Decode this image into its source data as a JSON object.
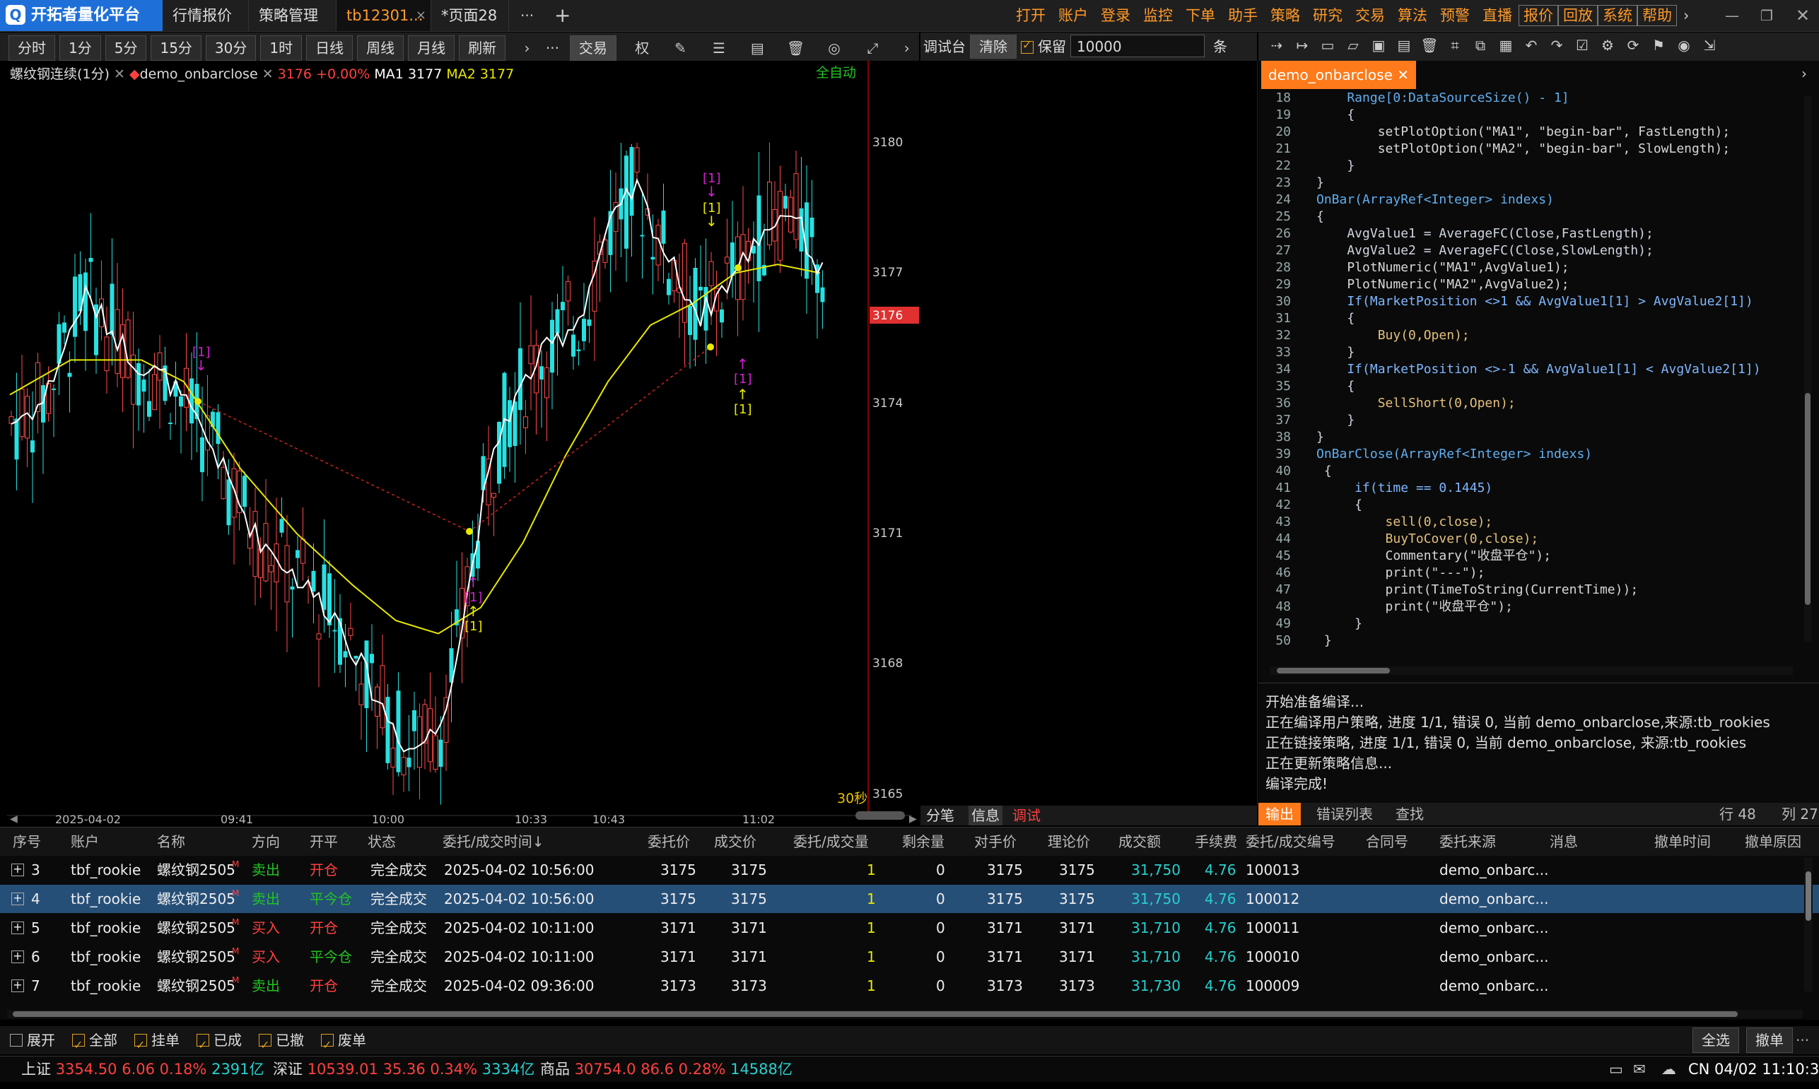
{
  "app": {
    "title": "开拓者量化平台"
  },
  "tabs": [
    {
      "label": "行情报价"
    },
    {
      "label": "策略管理"
    },
    {
      "label": "tb12301..."
    },
    {
      "label": "*页面28"
    }
  ],
  "top_menu": [
    "打开",
    "账户",
    "登录",
    "监控",
    "下单",
    "助手",
    "策略",
    "研究",
    "交易",
    "算法",
    "预警",
    "直播"
  ],
  "top_menu_boxed": [
    "报价",
    "回放",
    "系统",
    "帮助"
  ],
  "periods": [
    "分时",
    "1分",
    "5分",
    "15分",
    "30分",
    "1时",
    "日线",
    "周线",
    "月线",
    "刷新"
  ],
  "chart_toolbar": {
    "trade": "交易",
    "quan": "权"
  },
  "debug": {
    "label": "调试台",
    "clear": "清除",
    "keep": "保留",
    "count": "10000",
    "unit": "条"
  },
  "chart_header": {
    "symbol": "螺纹钢连续(1分)",
    "strategy": "demo_onbarclose",
    "price": "3176",
    "change": "+0.00%",
    "ma1_label": "MA1",
    "ma1_value": "3177",
    "ma2_label": "MA2",
    "ma2_value": "3177",
    "auto": "全自动",
    "countdown": "30秒"
  },
  "price_axis": [
    "3180",
    "3177",
    "3176",
    "3174",
    "3171",
    "3168",
    "3165"
  ],
  "time_axis": [
    "2025-04-02",
    "09:41",
    "10:00",
    "10:33",
    "10:43",
    "11:02"
  ],
  "signals": {
    "m": "[1]"
  },
  "editor": {
    "tab": "demo_onbarclose",
    "lines": [
      {
        "n": "18",
        "t": "    Range[0:DataSourceSize() - 1]"
      },
      {
        "n": "19",
        "t": "    {"
      },
      {
        "n": "20",
        "t": "        setPlotOption(\"MA1\", \"begin-bar\", FastLength);"
      },
      {
        "n": "21",
        "t": "        setPlotOption(\"MA2\", \"begin-bar\", SlowLength);"
      },
      {
        "n": "22",
        "t": "    }"
      },
      {
        "n": "23",
        "t": "}"
      },
      {
        "n": "24",
        "t": "OnBar(ArrayRef<Integer> indexs)"
      },
      {
        "n": "25",
        "t": "{"
      },
      {
        "n": "26",
        "t": "    AvgValue1 = AverageFC(Close,FastLength);"
      },
      {
        "n": "27",
        "t": "    AvgValue2 = AverageFC(Close,SlowLength);"
      },
      {
        "n": "28",
        "t": "    PlotNumeric(\"MA1\",AvgValue1);"
      },
      {
        "n": "29",
        "t": "    PlotNumeric(\"MA2\",AvgValue2);"
      },
      {
        "n": "30",
        "t": "    If(MarketPosition <>1 && AvgValue1[1] > AvgValue2[1])"
      },
      {
        "n": "31",
        "t": "    {"
      },
      {
        "n": "32",
        "t": "        Buy(0,Open);"
      },
      {
        "n": "33",
        "t": "    }"
      },
      {
        "n": "34",
        "t": "    If(MarketPosition <>-1 && AvgValue1[1] < AvgValue2[1])"
      },
      {
        "n": "35",
        "t": "    {"
      },
      {
        "n": "36",
        "t": "        SellShort(0,Open);"
      },
      {
        "n": "37",
        "t": "    }"
      },
      {
        "n": "38",
        "t": "}"
      },
      {
        "n": "39",
        "t": "OnBarClose(ArrayRef<Integer> indexs)"
      },
      {
        "n": "40",
        "t": " {"
      },
      {
        "n": "41",
        "t": "     if(time == 0.1445)"
      },
      {
        "n": "42",
        "t": "     {"
      },
      {
        "n": "43",
        "t": "         sell(0,close);"
      },
      {
        "n": "44",
        "t": "         BuyToCover(0,close);"
      },
      {
        "n": "45",
        "t": "         Commentary(\"收盘平仓\");"
      },
      {
        "n": "46",
        "t": "         print(\"---\");"
      },
      {
        "n": "47",
        "t": "         print(TimeToString(CurrentTime));"
      },
      {
        "n": "48",
        "t": "         print(\"收盘平仓\");"
      },
      {
        "n": "49",
        "t": "     }"
      },
      {
        "n": "50",
        "t": " }"
      }
    ]
  },
  "output": {
    "lines": [
      "开始准备编译...",
      "正在编译用户策略, 进度 1/1, 错误 0, 当前 demo_onbarclose,来源:tb_rookies",
      "正在链接策略, 进度 1/1, 错误 0, 当前 demo_onbarclose, 来源:tb_rookies",
      "正在更新策略信息...",
      "编译完成!"
    ],
    "tabs": [
      "输出",
      "错误列表",
      "查找"
    ],
    "row": "行 48",
    "col": "列 27"
  },
  "middle_tabs": [
    "分笔",
    "信息",
    "调试"
  ],
  "orders": {
    "headers": [
      "序号",
      "账户",
      "名称",
      "方向",
      "开平",
      "状态",
      "委托/成交时间↓",
      "委托价",
      "成交价",
      "委托/成交量",
      "剩余量",
      "对手价",
      "理论价",
      "成交额",
      "手续费",
      "委托/成交编号",
      "合同号",
      "委托来源",
      "消息",
      "撤单时间",
      "撤单原因"
    ],
    "rows": [
      {
        "no": "3",
        "acct": "tbf_rookie",
        "name": "螺纹钢2505",
        "dir": "卖出",
        "oc": "开仓",
        "status": "完全成交",
        "time": "2025-04-02 10:56:00",
        "wprice": "3175",
        "fprice": "3175",
        "qty": "1",
        "remain": "0",
        "opp": "3175",
        "theo": "3175",
        "amount": "31,750",
        "fee": "4.76",
        "id": "100013",
        "src": "demo_onbarc..."
      },
      {
        "no": "4",
        "acct": "tbf_rookie",
        "name": "螺纹钢2505",
        "dir": "卖出",
        "oc": "平今仓",
        "status": "完全成交",
        "time": "2025-04-02 10:56:00",
        "wprice": "3175",
        "fprice": "3175",
        "qty": "1",
        "remain": "0",
        "opp": "3175",
        "theo": "3175",
        "amount": "31,750",
        "fee": "4.76",
        "id": "100012",
        "src": "demo_onbarc..."
      },
      {
        "no": "5",
        "acct": "tbf_rookie",
        "name": "螺纹钢2505",
        "dir": "买入",
        "oc": "开仓",
        "status": "完全成交",
        "time": "2025-04-02 10:11:00",
        "wprice": "3171",
        "fprice": "3171",
        "qty": "1",
        "remain": "0",
        "opp": "3171",
        "theo": "3171",
        "amount": "31,710",
        "fee": "4.76",
        "id": "100011",
        "src": "demo_onbarc..."
      },
      {
        "no": "6",
        "acct": "tbf_rookie",
        "name": "螺纹钢2505",
        "dir": "买入",
        "oc": "平今仓",
        "status": "完全成交",
        "time": "2025-04-02 10:11:00",
        "wprice": "3171",
        "fprice": "3171",
        "qty": "1",
        "remain": "0",
        "opp": "3171",
        "theo": "3171",
        "amount": "31,710",
        "fee": "4.76",
        "id": "100010",
        "src": "demo_onbarc..."
      },
      {
        "no": "7",
        "acct": "tbf_rookie",
        "name": "螺纹钢2505",
        "dir": "卖出",
        "oc": "开仓",
        "status": "完全成交",
        "time": "2025-04-02 09:36:00",
        "wprice": "3173",
        "fprice": "3173",
        "qty": "1",
        "remain": "0",
        "opp": "3173",
        "theo": "3173",
        "amount": "31,730",
        "fee": "4.76",
        "id": "100009",
        "src": "demo_onbarc..."
      }
    ]
  },
  "filters": [
    {
      "label": "展开",
      "on": false
    },
    {
      "label": "全部",
      "on": true
    },
    {
      "label": "挂单",
      "on": true
    },
    {
      "label": "已成",
      "on": true
    },
    {
      "label": "已撤",
      "on": true
    },
    {
      "label": "废单",
      "on": true
    }
  ],
  "bottom_buttons": {
    "select_all": "全选",
    "cancel": "撤单"
  },
  "status_bar": {
    "sh": {
      "label": "上证",
      "value": "3354.50",
      "chg": "6.06",
      "pct": "0.18%",
      "amt": "2391亿"
    },
    "sz": {
      "label": "深证",
      "value": "10539.01",
      "chg": "35.36",
      "pct": "0.34%",
      "amt": "3334亿"
    },
    "sp": {
      "label": "商品",
      "value": "30754.0",
      "chg": "86.6",
      "pct": "0.28%",
      "amt": "14588亿"
    },
    "clock": "CN 04/02 11:10:31"
  }
}
